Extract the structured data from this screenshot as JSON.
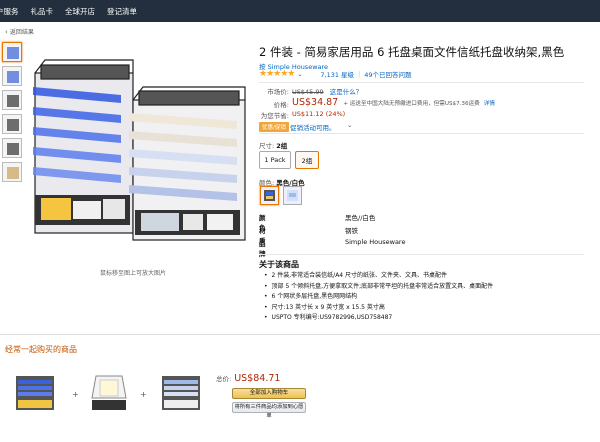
{
  "nav": {
    "items": [
      "户服务",
      "礼品卡",
      "全球开店",
      "登记清单"
    ]
  },
  "breadcrumb": {
    "back": "返回结果"
  },
  "gallery": {
    "zoom_hint": "鼠标移至图上可放大图片"
  },
  "product": {
    "title": "2 件装 - 简易家居用品 6 托盘桌面文件信纸托盘收纳架,黑色",
    "brand_link": "按 Simple Houseware",
    "rating_stars": "★★★★★",
    "rating_count": "7,131 星级",
    "answered": "49个已回答问题"
  },
  "pricing": {
    "list_label": "市场价:",
    "list_value": "US$45.99",
    "list_link": "这是什么？",
    "price_label": "价格:",
    "price_value": "US$34.87",
    "shipping_text": "+ 运送至中国大陆无预缴进口费用，但需US$7.36运费",
    "shipping_link": "详情",
    "save_label": "为您节省:",
    "save_value": "US$11.12 (24%)",
    "promo_badge": "优惠/促销",
    "promo_link": "促销活动可用。"
  },
  "size": {
    "label": "尺寸:",
    "selected": "2组",
    "options": [
      "1 Pack",
      "2组"
    ]
  },
  "color": {
    "label": "颜色:",
    "selected": "黑色/白色"
  },
  "specs": [
    {
      "k": "颜色",
      "v": "黑色//白色"
    },
    {
      "k": "材质",
      "v": "钢铁"
    },
    {
      "k": "品牌",
      "v": "Simple Houseware"
    }
  ],
  "about": {
    "heading": "关于该商品",
    "bullets": [
      "2 件装,非常适合装信纸/A4 尺寸的纸张、文件夹、文具、书桌配件",
      "顶部 5 个倾斜托盘,方便拿取文件;底部非常平坦的托盘非常适合放置文具、桌面配件",
      "6 个网状多层托盘,黑色网网结构",
      "尺寸:13 英寸长 x 9 英寸宽 x 15.5 英寸高",
      "USPTO 专利编号:US9782996,USD758487"
    ]
  },
  "fbt": {
    "heading": "经常一起购买的商品",
    "total_label": "总价:",
    "total_value": "US$84.71",
    "add_cart": "全部加入购物车",
    "add_list": "将所有三件商品均添加到心愿单"
  },
  "colors": {
    "price": "#b12704",
    "link": "#0066c0",
    "nav": "#232f3e",
    "fbt_heading": "#c45500"
  }
}
